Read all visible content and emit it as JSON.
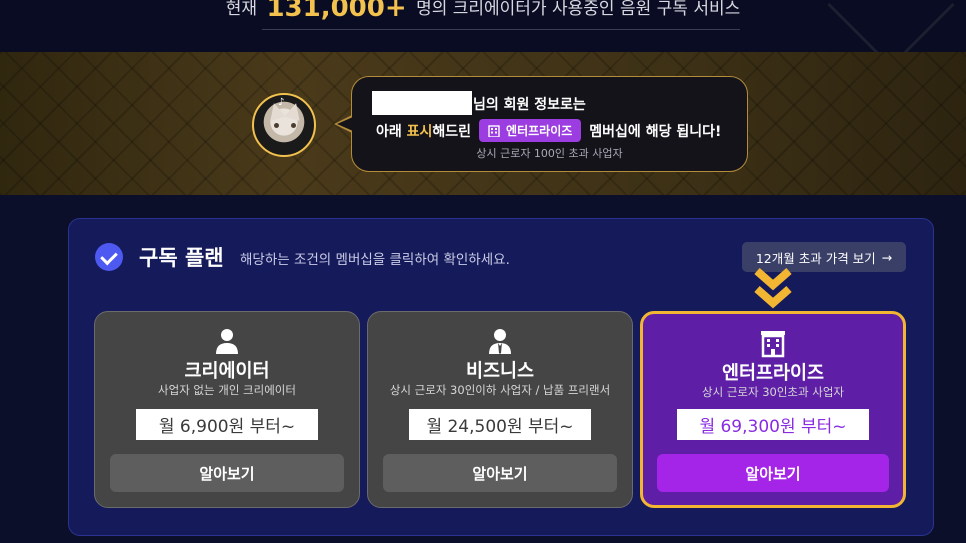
{
  "header": {
    "prefix": "현재",
    "count": "131,000+",
    "suffix": "명의 크리에이터가 사용중인 음원 구독 서비스"
  },
  "membership_notice": {
    "line1_suffix": "님의 회원 정보로는",
    "line2_before": "아래",
    "line2_highlight": "표시",
    "line2_mid": "해드린",
    "badge_label": "엔터프라이즈",
    "line2_after": "멤버십에 해당 됩니다!",
    "line3": "상시 근로자 100인 초과 사업자"
  },
  "plans": {
    "title": "구독 플랜",
    "subtitle": "해당하는 조건의 멤버십을 클릭하여 확인하세요.",
    "price_button_label": "12개월 초과 가격 보기",
    "price_button_arrow": "→",
    "items": [
      {
        "icon": "person-icon",
        "name": "크리에이터",
        "description": "사업자 없는 개인 크리에이터",
        "price": "월 6,900원 부터~",
        "button": "알아보기"
      },
      {
        "icon": "business-person-icon",
        "name": "비즈니스",
        "description": "상시 근로자 30인이하 사업자 / 납품 프리랜서",
        "price": "월 24,500원 부터~",
        "button": "알아보기"
      },
      {
        "icon": "building-icon",
        "name": "엔터프라이즈",
        "description": "상시 근로자 30인초과 사업자",
        "price": "월 69,300원 부터~",
        "button": "알아보기",
        "selected": true
      }
    ]
  },
  "colors": {
    "accent_gold": "#f2c14e",
    "accent_purple": "#a425e8",
    "panel_bg": "#141a5a"
  }
}
